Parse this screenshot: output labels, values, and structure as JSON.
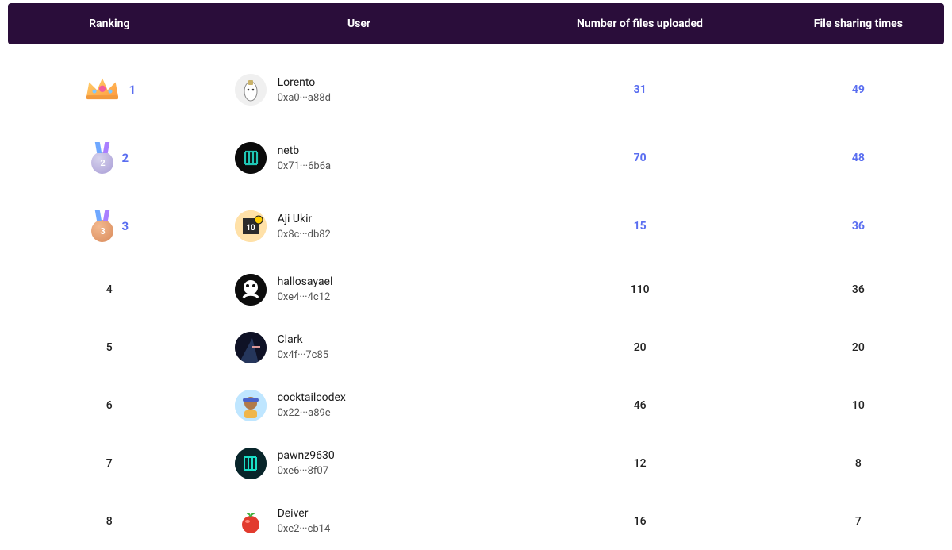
{
  "header": {
    "rank": "Ranking",
    "user": "User",
    "files": "Number of files uploaded",
    "share": "File sharing times"
  },
  "rows": [
    {
      "rank": 1,
      "name": "Lorento",
      "addr": "0xa0···a88d",
      "files": 31,
      "share": 49,
      "top": true,
      "avatar": "av1"
    },
    {
      "rank": 2,
      "name": "netb",
      "addr": "0x71···6b6a",
      "files": 70,
      "share": 48,
      "top": true,
      "avatar": "av2"
    },
    {
      "rank": 3,
      "name": "Aji Ukir",
      "addr": "0x8c···db82",
      "files": 15,
      "share": 36,
      "top": true,
      "avatar": "av3"
    },
    {
      "rank": 4,
      "name": "hallosayael",
      "addr": "0xe4···4c12",
      "files": 110,
      "share": 36,
      "top": false,
      "avatar": "av4"
    },
    {
      "rank": 5,
      "name": "Clark",
      "addr": "0x4f···7c85",
      "files": 20,
      "share": 20,
      "top": false,
      "avatar": "av5"
    },
    {
      "rank": 6,
      "name": "cocktailcodex",
      "addr": "0x22···a89e",
      "files": 46,
      "share": 10,
      "top": false,
      "avatar": "av6"
    },
    {
      "rank": 7,
      "name": "pawnz9630",
      "addr": "0xe6···8f07",
      "files": 12,
      "share": 8,
      "top": false,
      "avatar": "av7"
    },
    {
      "rank": 8,
      "name": "Deiver",
      "addr": "0xe2···cb14",
      "files": 16,
      "share": 7,
      "top": false,
      "avatar": "av8"
    }
  ]
}
